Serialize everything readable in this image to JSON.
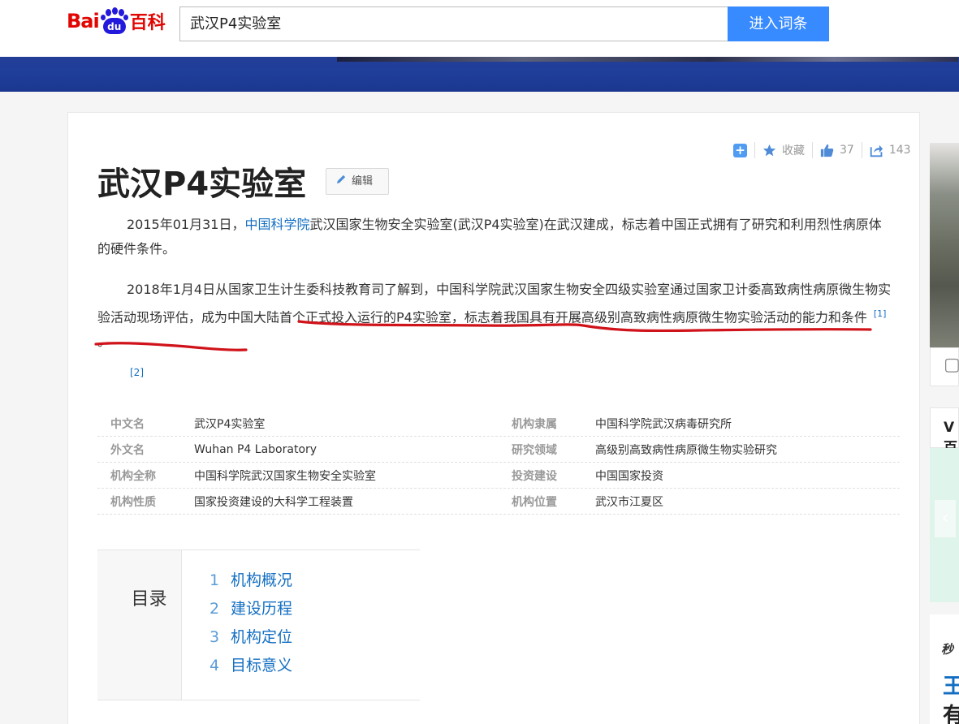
{
  "header": {
    "logo_bai": "Bai",
    "logo_du": "du",
    "logo_baike": "百科",
    "search_value": "武汉P4实验室",
    "search_button": "进入词条"
  },
  "toolbar": {
    "favorite_label": "收藏",
    "like_count": "37",
    "share_count": "143"
  },
  "article": {
    "title": "武汉P4实验室",
    "edit_label": "编辑",
    "para1_prefix": "2015年01月31日，",
    "para1_link": "中国科学院",
    "para1_suffix": "武汉国家生物安全实验室(武汉P4实验室)在武汉建成，标志着中国正式拥有了研究和利用烈性病原体的硬件条件。",
    "para2_text": "2018年1月4日从国家卫生计生委科技教育司了解到，中国科学院武汉国家生物安全四级实验室通过国家卫计委高致病性病原微生物实验活动现场评估，成为中国大陆首个正式投入运行的P4实验室，标志着我国具有开展高级别高致病性病原微生物实验活动的能力和条件",
    "para2_ref": "[1]",
    "para2_end": "。",
    "ref2": "[2]"
  },
  "basic_info": [
    {
      "name": "中文名",
      "value": "武汉P4实验室",
      "name2": "机构隶属",
      "value2": "中国科学院武汉病毒研究所"
    },
    {
      "name": "外文名",
      "value": "Wuhan P4 Laboratory",
      "name2": "研究领域",
      "value2": "高级别高致病性病原微生物实验研究"
    },
    {
      "name": "机构全称",
      "value": "中国科学院武汉国家生物安全实验室",
      "name2": "投资建设",
      "value2": "中国国家投资"
    },
    {
      "name": "机构性质",
      "value": "国家投资建设的大科学工程装置",
      "name2": "机构位置",
      "value2": "武汉市江夏区"
    }
  ],
  "toc": {
    "label": "目录",
    "items": [
      {
        "num": "1",
        "text": "机构概况"
      },
      {
        "num": "2",
        "text": "建设历程"
      },
      {
        "num": "3",
        "text": "机构定位"
      },
      {
        "num": "4",
        "text": "目标意义"
      }
    ]
  },
  "sidebar": {
    "v_label": "V百",
    "bottom_italic": "秒",
    "bottom_blue": "王",
    "bottom_dark": "有"
  },
  "colors": {
    "brand_red": "#e10602",
    "brand_blue": "#2319dc",
    "button_blue": "#388bff",
    "link_blue": "#136ec2",
    "annotation_red": "#d0131a"
  },
  "icons": [
    "search-icon",
    "plus-icon",
    "star-icon",
    "thumbs-up-icon",
    "share-icon",
    "pencil-icon",
    "image-icon",
    "chevron-left-icon"
  ]
}
